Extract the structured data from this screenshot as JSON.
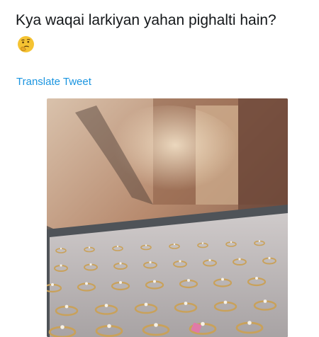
{
  "tweet": {
    "text": "Kya waqai larkiyan yahan pighalti hain?",
    "emoji": "thinking-face",
    "translate_label": "Translate Tweet"
  },
  "media": {
    "subject": "jewelry-ring-display-tray",
    "colors": {
      "velvet": "#b9b4b4",
      "gold": "#c9a15a",
      "tray_edge": "#5f6266",
      "background_warm": "#9a6a52"
    }
  }
}
